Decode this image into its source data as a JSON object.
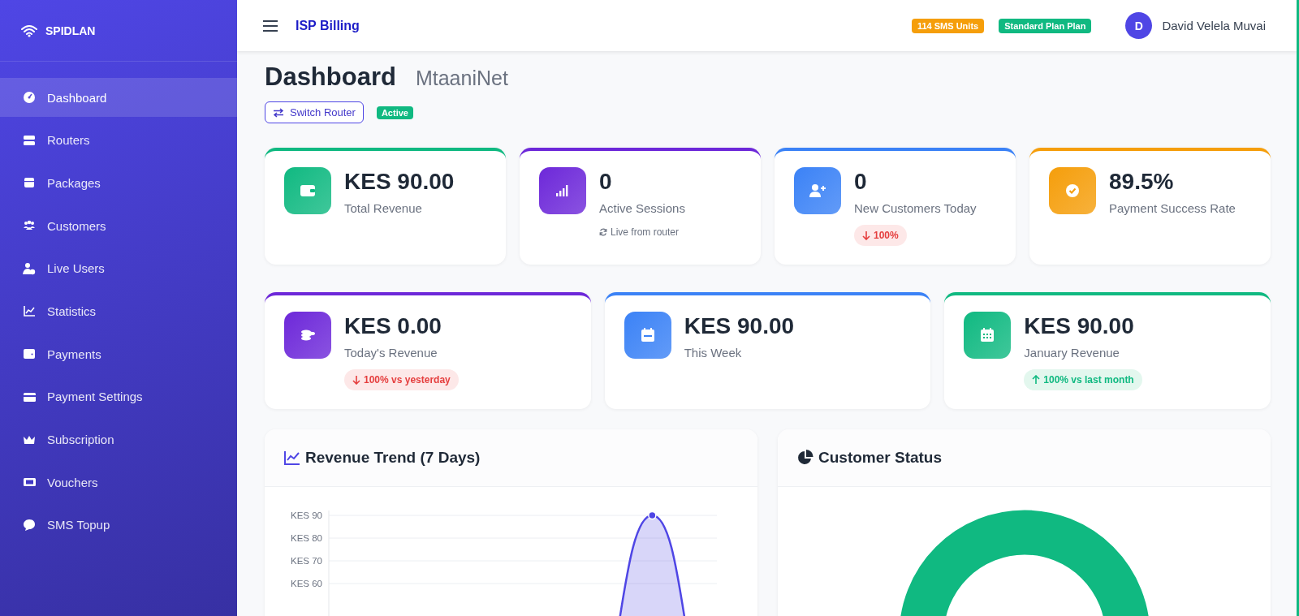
{
  "sidebar": {
    "brand": "SPIDLAN",
    "items": [
      {
        "label": "Dashboard",
        "selected": true
      },
      {
        "label": "Routers",
        "selected": false
      },
      {
        "label": "Packages",
        "selected": false
      },
      {
        "label": "Customers",
        "selected": false
      },
      {
        "label": "Live Users",
        "selected": false
      },
      {
        "label": "Statistics",
        "selected": false
      },
      {
        "label": "Payments",
        "selected": false
      },
      {
        "label": "Payment Settings",
        "selected": false
      },
      {
        "label": "Subscription",
        "selected": false
      },
      {
        "label": "Vouchers",
        "selected": false
      },
      {
        "label": "SMS Topup",
        "selected": false
      }
    ]
  },
  "topbar": {
    "title": "ISP Billing",
    "badges": [
      {
        "text": "114 SMS Units",
        "color": "#f59e0b"
      },
      {
        "text": "Standard Plan Plan",
        "color": "#10b981"
      }
    ],
    "user": {
      "initial": "D",
      "name": "David Velela Muvai"
    }
  },
  "header": {
    "title": "Dashboard",
    "subtitle": "MtaaniNet",
    "switch_button": "Switch Router",
    "status": "Active"
  },
  "stats_top": [
    {
      "value": "KES 90.00",
      "label": "Total Revenue",
      "color": "#10b981"
    },
    {
      "value": "0",
      "label": "Active Sessions",
      "color": "#6d28d9",
      "note": {
        "kind": "live",
        "text": "Live from router"
      }
    },
    {
      "value": "0",
      "label": "New Customers Today",
      "color": "#3b82f6",
      "note": {
        "kind": "down",
        "text": "100%"
      }
    },
    {
      "value": "89.5%",
      "label": "Payment Success Rate",
      "color": "#f59e0b"
    }
  ],
  "stats_bottom": [
    {
      "value": "KES 0.00",
      "label": "Today's Revenue",
      "color": "#6d28d9",
      "note": {
        "kind": "down",
        "text": "100% vs yesterday"
      }
    },
    {
      "value": "KES 90.00",
      "label": "This Week",
      "color": "#3b82f6"
    },
    {
      "value": "KES 90.00",
      "label": "January Revenue",
      "color": "#10b981",
      "note": {
        "kind": "up",
        "text": "100% vs last month"
      }
    }
  ],
  "panels": [
    {
      "kind": "chart",
      "title": "Revenue Trend (7 Days)",
      "axis_labels": [
        "KES 90",
        "KES 80",
        "KES 70",
        "KES 60"
      ]
    },
    {
      "kind": "donut",
      "title": "Customer Status"
    }
  ]
}
